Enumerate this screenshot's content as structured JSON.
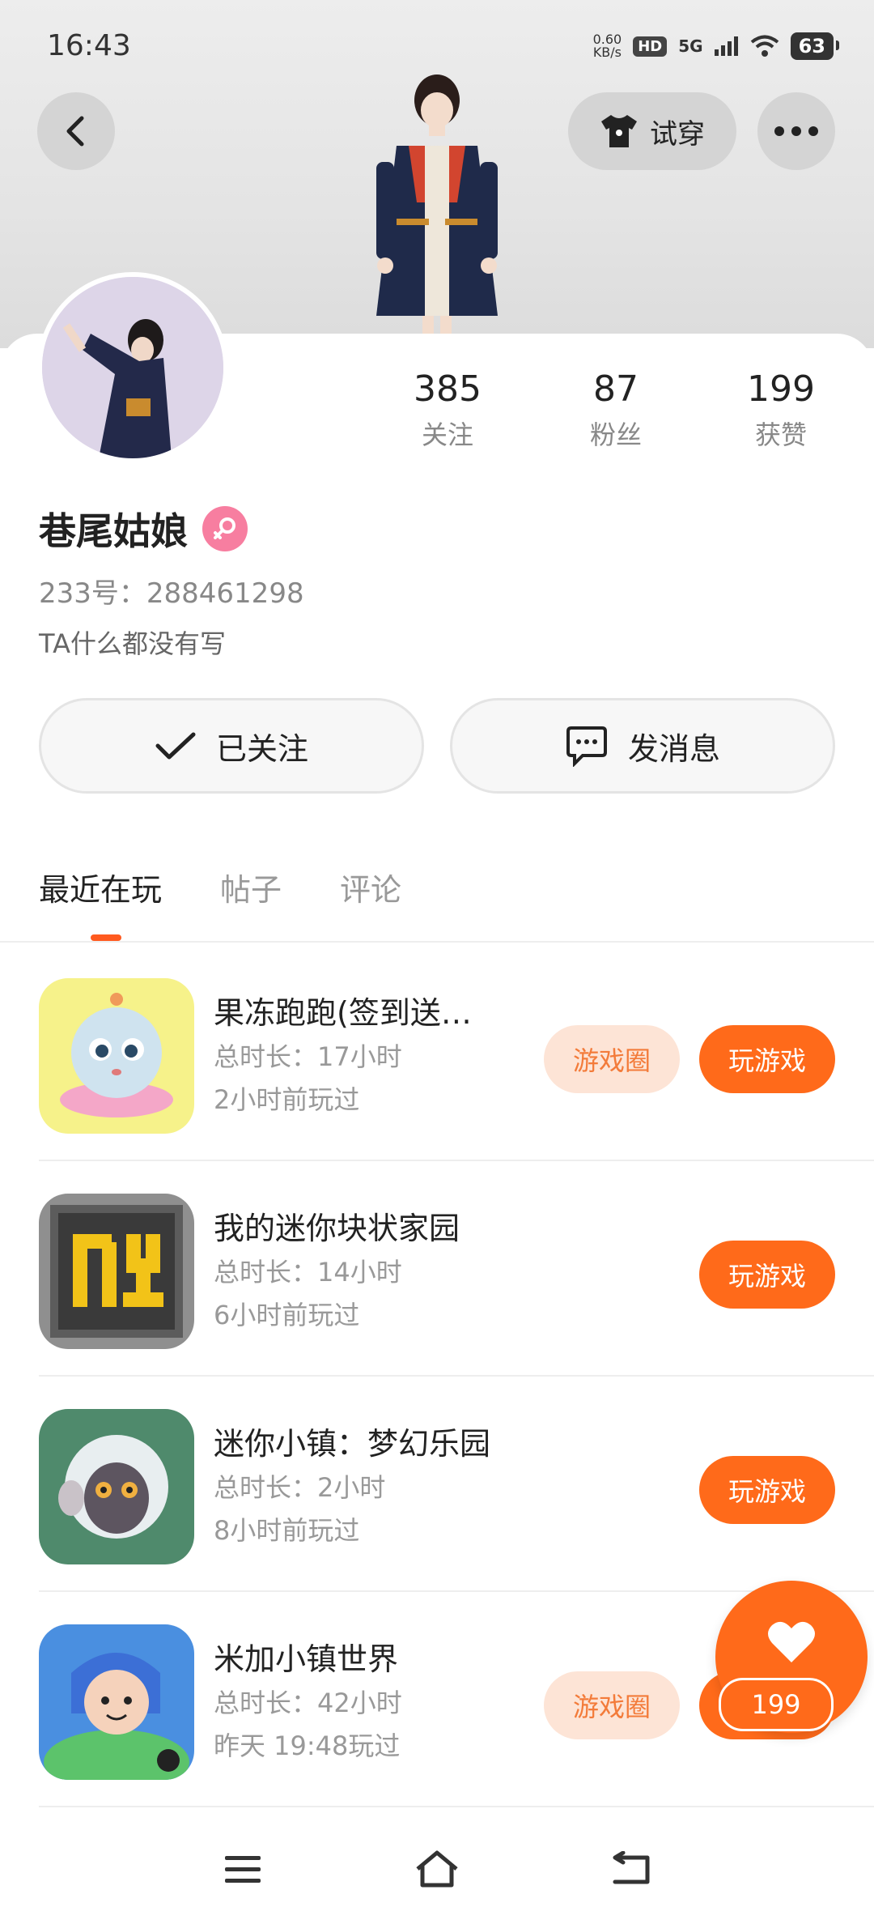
{
  "status_bar": {
    "time": "16:43",
    "speed_value": "0.60",
    "speed_unit": "KB/s",
    "hd": "HD",
    "network": "5G",
    "battery": "63"
  },
  "header": {
    "try_on_label": "试穿",
    "back_icon": "chevron-left-icon",
    "more_icon": "more-dots-icon"
  },
  "profile": {
    "name": "巷尾姑娘",
    "gender": "female",
    "uid": "233号：288461298",
    "bio": "TA什么都没有写",
    "stats": [
      {
        "value": "385",
        "label": "关注"
      },
      {
        "value": "87",
        "label": "粉丝"
      },
      {
        "value": "199",
        "label": "获赞"
      }
    ]
  },
  "actions": {
    "follow_label": "已关注",
    "message_label": "发消息"
  },
  "tabs": [
    {
      "label": "最近在玩",
      "active": true
    },
    {
      "label": "帖子",
      "active": false
    },
    {
      "label": "评论",
      "active": false
    }
  ],
  "games": [
    {
      "title": "果冻跑跑(签到送…",
      "duration": "总时长：17小时",
      "last_played": "2小时前玩过",
      "circle_label": "游戏圈",
      "play_label": "玩游戏"
    },
    {
      "title": "我的迷你块状家园",
      "duration": "总时长：14小时",
      "last_played": "6小时前玩过",
      "play_label": "玩游戏"
    },
    {
      "title": "迷你小镇：梦幻乐园",
      "duration": "总时长：2小时",
      "last_played": "8小时前玩过",
      "play_label": "玩游戏"
    },
    {
      "title": "米加小镇世界",
      "duration": "总时长：42小时",
      "last_played": "昨天 19:48玩过",
      "circle_label": "游戏圈",
      "play_label": "玩游戏"
    }
  ],
  "like_widget": {
    "count": "199"
  },
  "colors": {
    "accent": "#ff6a1a",
    "accent_soft": "#fde4d6",
    "gender_pink": "#f77ea0"
  }
}
